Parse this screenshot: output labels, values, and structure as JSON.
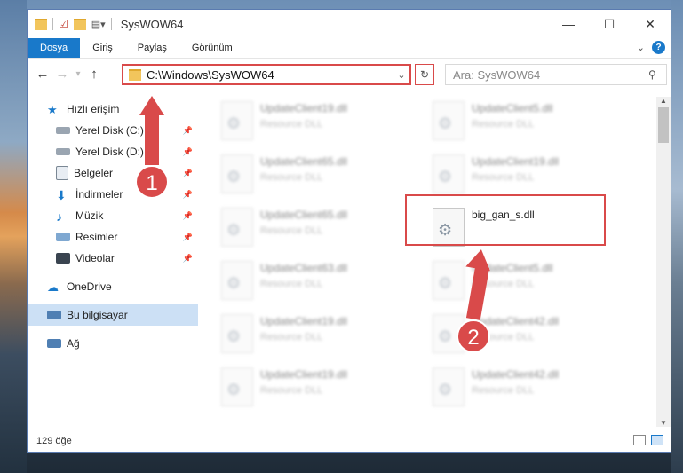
{
  "window": {
    "title": "SysWOW64",
    "minimize": "—",
    "maximize": "☐",
    "close": "✕"
  },
  "ribbon": {
    "tabs": [
      {
        "label": "Dosya",
        "active": true
      },
      {
        "label": "Giriş"
      },
      {
        "label": "Paylaş"
      },
      {
        "label": "Görünüm"
      }
    ],
    "help": "?"
  },
  "nav": {
    "back": "←",
    "forward": "→",
    "recent": "▾",
    "up": "↑",
    "address": "C:\\Windows\\SysWOW64",
    "refresh": "↻",
    "search_placeholder": "Ara: SysWOW64"
  },
  "sidebar": {
    "items": [
      {
        "label": "Hızlı erişim",
        "icon": "star-icon"
      },
      {
        "label": "Yerel Disk (C:)",
        "icon": "drive-icon"
      },
      {
        "label": "Yerel Disk (D:)",
        "icon": "drive-icon"
      },
      {
        "label": "Belgeler",
        "icon": "document-icon"
      },
      {
        "label": "İndirmeler",
        "icon": "download-icon"
      },
      {
        "label": "Müzik",
        "icon": "music-icon"
      },
      {
        "label": "Resimler",
        "icon": "pictures-icon"
      },
      {
        "label": "Videolar",
        "icon": "video-icon"
      },
      {
        "label": "OneDrive",
        "icon": "cloud-icon"
      },
      {
        "label": "Bu bilgisayar",
        "icon": "computer-icon"
      },
      {
        "label": "Ağ",
        "icon": "network-icon"
      }
    ]
  },
  "files": [
    {
      "name": "UpdateClient19.dll",
      "type": "Resource DLL"
    },
    {
      "name": "UpdateClient5.dll",
      "type": "Resource DLL"
    },
    {
      "name": "UpdateClient65.dll",
      "type": "Resource DLL"
    },
    {
      "name": "UpdateClient19.dll",
      "type": "Resource DLL"
    },
    {
      "name": "UpdateClient65.dll",
      "type": "Resource DLL"
    },
    {
      "name": "big_gan_s.dll",
      "type": ""
    },
    {
      "name": "UpdateClient63.dll",
      "type": "Resource DLL"
    },
    {
      "name": "UpdateClient5.dll",
      "type": "Resource DLL"
    },
    {
      "name": "UpdateClient19.dll",
      "type": "Resource DLL"
    },
    {
      "name": "UpdateClient42.dll",
      "type": "Resource DLL"
    },
    {
      "name": "UpdateClient19.dll",
      "type": "Resource DLL"
    },
    {
      "name": "UpdateClient42.dll",
      "type": "Resource DLL"
    }
  ],
  "status": {
    "count": "129 öğe"
  },
  "annotations": {
    "marker1": "1",
    "marker2": "2",
    "color": "#d94a4a"
  }
}
